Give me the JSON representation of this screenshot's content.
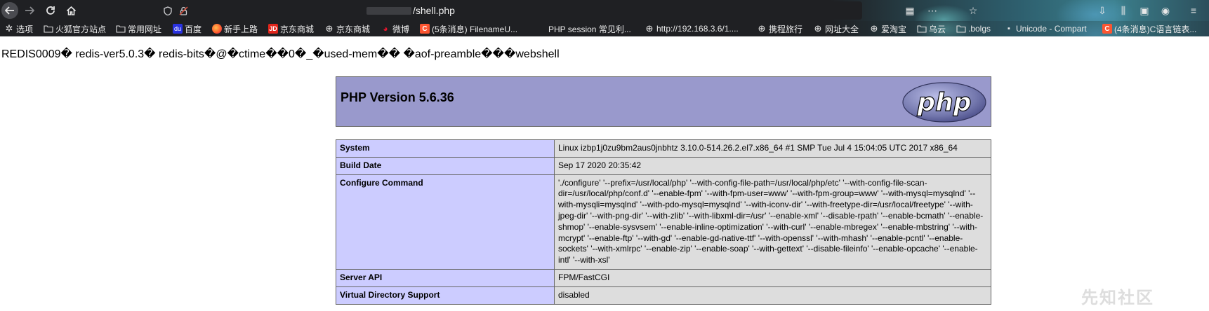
{
  "browser": {
    "url": "/shell.php",
    "bookmarks": [
      {
        "label": "选项",
        "icon": "gear-icon"
      },
      {
        "label": "火狐官方站点",
        "icon": "folder-icon"
      },
      {
        "label": "常用网址",
        "icon": "folder-icon"
      },
      {
        "label": "百度",
        "icon": "baidu-icon"
      },
      {
        "label": "新手上路",
        "icon": "firefox-icon"
      },
      {
        "label": "京东商城",
        "icon": "jd-icon"
      },
      {
        "label": "京东商城",
        "icon": "globe-icon"
      },
      {
        "label": "微博",
        "icon": "weibo-icon"
      },
      {
        "label": "(5条消息) FilenameU...",
        "icon": "csdn-icon"
      },
      {
        "label": "PHP session 常见利...",
        "icon": "page-icon"
      },
      {
        "label": "http://192.168.3.6/1....",
        "icon": "globe-icon"
      },
      {
        "label": "携程旅行",
        "icon": "globe-icon"
      },
      {
        "label": "网址大全",
        "icon": "globe-icon"
      },
      {
        "label": "爱淘宝",
        "icon": "globe-icon"
      },
      {
        "label": "乌云",
        "icon": "folder-icon"
      },
      {
        "label": ".bolgs",
        "icon": "folder-icon"
      },
      {
        "label": "Unicode - Compart",
        "icon": "page-icon"
      },
      {
        "label": "(4条消息)C语言链表...",
        "icon": "csdn-icon"
      }
    ]
  },
  "page": {
    "redis_dump": "REDIS0009� redis-ver5.0.3� redis-bits�@�ctime��0�_�used-mem�� �aof-preamble���webshell",
    "php_version_title": "PHP Version 5.6.36",
    "logo_text": "php",
    "rows": [
      {
        "label": "System",
        "value": "Linux izbp1j0zu9bm2aus0jnbhtz 3.10.0-514.26.2.el7.x86_64 #1 SMP Tue Jul 4 15:04:05 UTC 2017 x86_64"
      },
      {
        "label": "Build Date",
        "value": "Sep 17 2020 20:35:42"
      },
      {
        "label": "Configure Command",
        "value": "'./configure' '--prefix=/usr/local/php' '--with-config-file-path=/usr/local/php/etc' '--with-config-file-scan-dir=/usr/local/php/conf.d' '--enable-fpm' '--with-fpm-user=www' '--with-fpm-group=www' '--with-mysql=mysqlnd' '--with-mysqli=mysqlnd' '--with-pdo-mysql=mysqlnd' '--with-iconv-dir' '--with-freetype-dir=/usr/local/freetype' '--with-jpeg-dir' '--with-png-dir' '--with-zlib' '--with-libxml-dir=/usr' '--enable-xml' '--disable-rpath' '--enable-bcmath' '--enable-shmop' '--enable-sysvsem' '--enable-inline-optimization' '--with-curl' '--enable-mbregex' '--enable-mbstring' '--with-mcrypt' '--enable-ftp' '--with-gd' '--enable-gd-native-ttf' '--with-openssl' '--with-mhash' '--enable-pcntl' '--enable-sockets' '--with-xmlrpc' '--enable-zip' '--enable-soap' '--with-gettext' '--disable-fileinfo' '--enable-opcache' '--enable-intl' '--with-xsl'"
      },
      {
        "label": "Server API",
        "value": "FPM/FastCGI"
      },
      {
        "label": "Virtual Directory Support",
        "value": "disabled"
      }
    ],
    "watermark": "先知社区"
  }
}
